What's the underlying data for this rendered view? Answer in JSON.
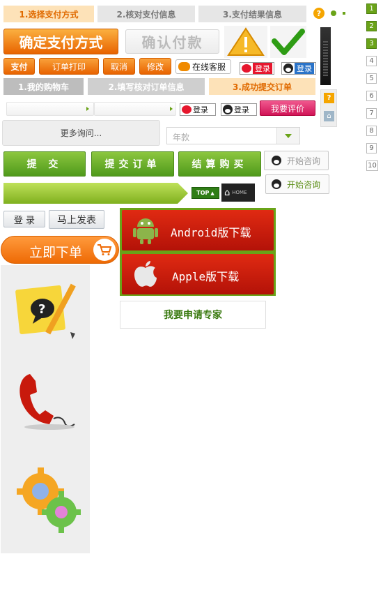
{
  "steps_top": [
    "1.选择支付方式",
    "2.核对支付信息",
    "3.支付结果信息"
  ],
  "big_buttons": {
    "confirm_method": "确定支付方式",
    "confirm_pay": "确认付款"
  },
  "small_buttons": {
    "pay": "支付",
    "print": "订单打印",
    "cancel": "取消",
    "edit": "修改",
    "online_service": "在线客服",
    "login": "登录"
  },
  "steps_cart": [
    "1.我的购物车",
    "2.填写核对订单信息",
    "3.成功提交订单"
  ],
  "review_button": "我要评价",
  "more_inquiry": "更多询问...",
  "select_year": "年款",
  "green_buttons": {
    "submit": "提 交",
    "submit_order": "提交订单",
    "checkout": "结算购买"
  },
  "consult_label": "开始咨询",
  "top_label": "TOP",
  "home_label": "HOME",
  "plain_buttons": {
    "login": "登 录",
    "post_now": "马上发表"
  },
  "order_now": "立即下单",
  "downloads": {
    "android": "Android版下载",
    "apple": "Apple版下载"
  },
  "expert_apply": "我要申请专家",
  "pager": [
    "1",
    "2",
    "3",
    "4",
    "5",
    "6",
    "7",
    "8",
    "9",
    "10"
  ],
  "colors": {
    "green": "#6aa318",
    "orange": "#f07c1a",
    "red": "#c8190c"
  }
}
